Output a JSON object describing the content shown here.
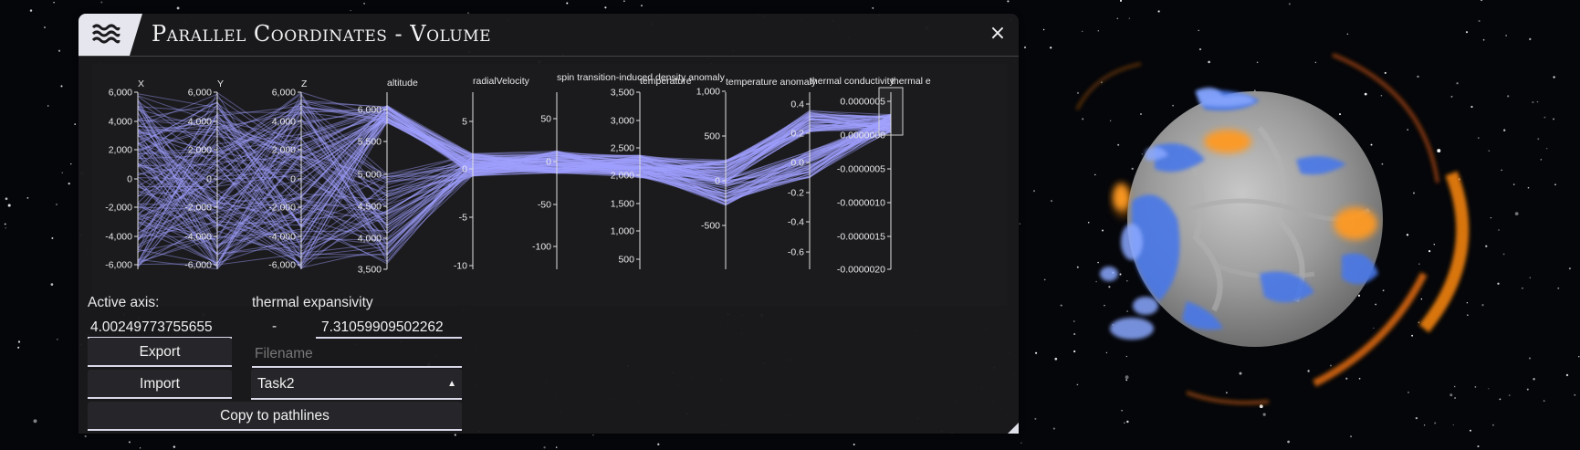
{
  "window": {
    "title": "Parallel Coordinates - Volume",
    "close_symbol": "×",
    "menu_icon": "waves-menu-icon"
  },
  "pcp": {
    "axes": [
      {
        "name": "X",
        "ticks": [
          "6,000",
          "4,000",
          "2,000",
          "0",
          "-2,000",
          "-4,000",
          "-6,000"
        ]
      },
      {
        "name": "Y",
        "ticks": [
          "6,000",
          "4,000",
          "2,000",
          "0",
          "-2,000",
          "-4,000",
          "-6,000"
        ]
      },
      {
        "name": "Z",
        "ticks": [
          "6,000",
          "4,000",
          "2,000",
          "0",
          "-2,000",
          "-4,000",
          "-6,000"
        ]
      },
      {
        "name": "altitude",
        "ticks": [
          "6,000",
          "5,500",
          "5,000",
          "4,500",
          "4,000",
          "3,500"
        ]
      },
      {
        "name": "radialVelocity",
        "ticks": [
          "5",
          "0",
          "-5",
          "-10"
        ]
      },
      {
        "name": "spin transition-induced density anomaly",
        "ticks": [
          "50",
          "0",
          "-50",
          "-100"
        ]
      },
      {
        "name": "temperature",
        "ticks": [
          "3,500",
          "3,000",
          "2,500",
          "2,000",
          "1,500",
          "1,000",
          "500"
        ]
      },
      {
        "name": "temperature anomaly",
        "ticks": [
          "1,000",
          "500",
          "0",
          "-500"
        ]
      },
      {
        "name": "thermal conductivity",
        "ticks": [
          "0.4",
          "0.2",
          "0.0",
          "-0.2",
          "-0.4",
          "-0.6"
        ]
      },
      {
        "name": "thermal e",
        "ticks": [
          "0.0000005",
          "0.0000000",
          "-0.0000005",
          "-0.0000010",
          "-0.0000015",
          "-0.0000020"
        ]
      }
    ]
  },
  "controls": {
    "active_axis_label": "Active axis:",
    "active_axis_name": "thermal expansivity",
    "range_min": "4.00249773755655",
    "range_separator": "-",
    "range_max": "7.31059909502262",
    "export_label": "Export",
    "import_label": "Import",
    "filename_placeholder": "Filename",
    "selection_value": "Task2",
    "copy_label": "Copy to pathlines"
  },
  "colors": {
    "line": "#a0a0ff",
    "panel": "#1a1a1d",
    "accent": "#d8d8e8"
  }
}
